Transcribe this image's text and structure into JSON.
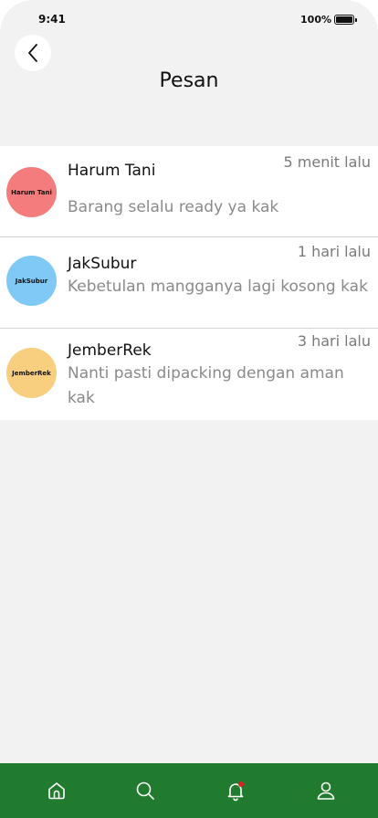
{
  "status_bar": {
    "time": "9:41",
    "battery": "100%"
  },
  "header": {
    "title": "Pesan"
  },
  "messages": [
    {
      "sender": "Harum Tani",
      "avatar_label": "Harum Tani",
      "avatar_color": "#f47c7c",
      "time": "5 menit lalu",
      "preview": "Barang selalu ready ya kak"
    },
    {
      "sender": "JakSubur",
      "avatar_label": "JakSubur",
      "avatar_color": "#7ec9f5",
      "time": "1 hari lalu",
      "preview": "Kebetulan mangganya lagi kosong kak"
    },
    {
      "sender": "JemberRek",
      "avatar_label": "JemberRek",
      "avatar_color": "#f7cf7f",
      "time": "3 hari lalu",
      "preview": "Nanti pasti dipacking dengan aman kak"
    }
  ],
  "bottom_nav": {
    "color": "#217b2f",
    "items": [
      "home-icon",
      "search-icon",
      "bell-icon",
      "user-icon"
    ],
    "notification_dot_color": "#e02020"
  }
}
